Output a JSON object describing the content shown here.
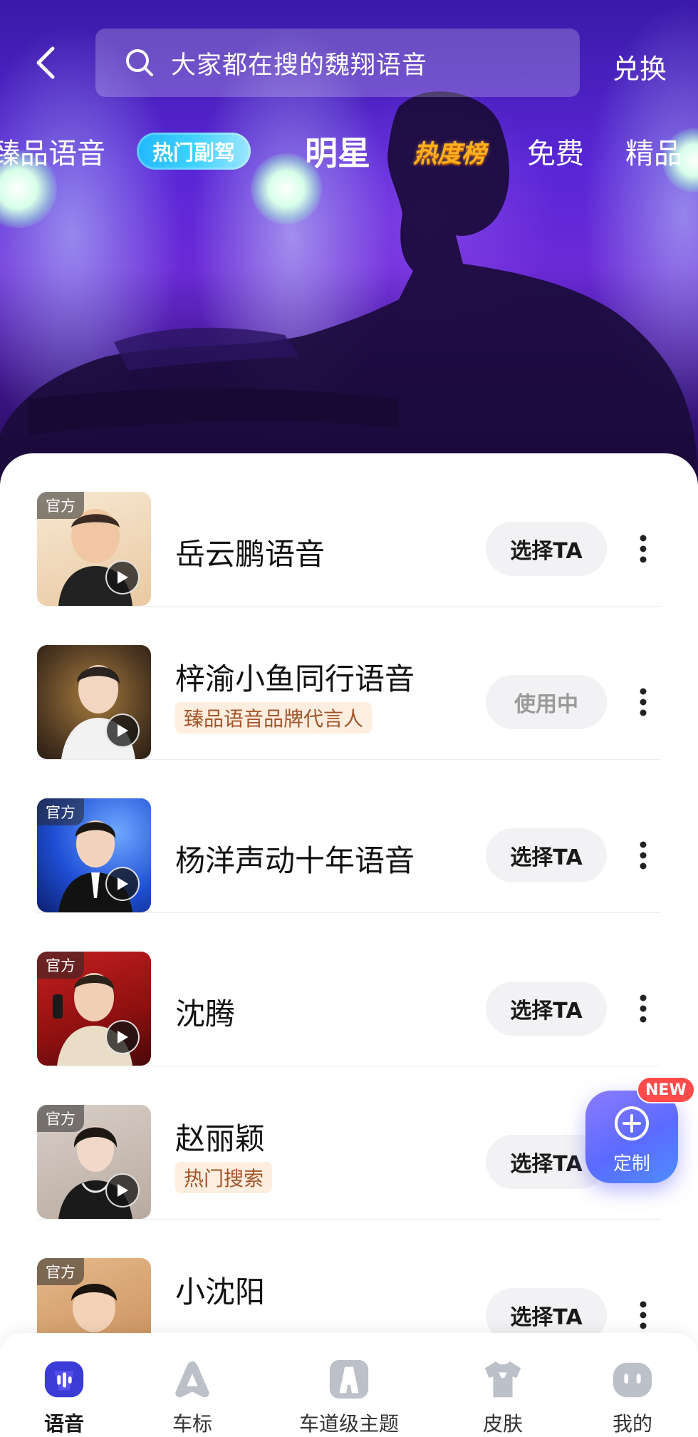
{
  "header": {
    "search_placeholder": "大家都在搜的魏翔语音",
    "redeem_label": "兑换"
  },
  "categories": [
    {
      "label": "臻品语音",
      "style": "normal"
    },
    {
      "label": "热门副驾",
      "style": "pill"
    },
    {
      "label": "明星",
      "style": "active"
    },
    {
      "label": "热度榜",
      "style": "rank"
    },
    {
      "label": "免费",
      "style": "normal"
    },
    {
      "label": "精品",
      "style": "normal"
    }
  ],
  "voices": [
    {
      "name": "岳云鹏语音",
      "official": true,
      "tag": "",
      "button": "选择TA",
      "in_use": false
    },
    {
      "name": "梓渝小鱼同行语音",
      "official": false,
      "tag": "臻品语音品牌代言人",
      "button": "使用中",
      "in_use": true
    },
    {
      "name": "杨洋声动十年语音",
      "official": true,
      "tag": "",
      "button": "选择TA",
      "in_use": false
    },
    {
      "name": "沈腾",
      "official": true,
      "tag": "",
      "button": "选择TA",
      "in_use": false
    },
    {
      "name": "赵丽颖",
      "official": true,
      "tag": "热门搜索",
      "button": "选择TA",
      "in_use": false
    },
    {
      "name": "小沈阳",
      "official": true,
      "tag": "",
      "button": "选择TA",
      "in_use": false
    }
  ],
  "official_badge": "官方",
  "fab": {
    "label": "定制",
    "badge": "NEW"
  },
  "bottom_nav": [
    {
      "label": "语音",
      "icon": "voice-icon",
      "active": true
    },
    {
      "label": "车标",
      "icon": "car-logo-icon",
      "active": false
    },
    {
      "label": "车道级主题",
      "icon": "lane-theme-icon",
      "active": false
    },
    {
      "label": "皮肤",
      "icon": "skin-icon",
      "active": false
    },
    {
      "label": "我的",
      "icon": "profile-icon",
      "active": false
    }
  ],
  "colors": {
    "hero_purple": "#5a26d6",
    "pill_blue": "#22b8ff",
    "rank_orange": "#ffb21f",
    "tag_bg": "#fdeee0",
    "tag_text": "#a3552a",
    "fab_blue": "#5b6bff",
    "new_red": "#ff4b4b"
  }
}
